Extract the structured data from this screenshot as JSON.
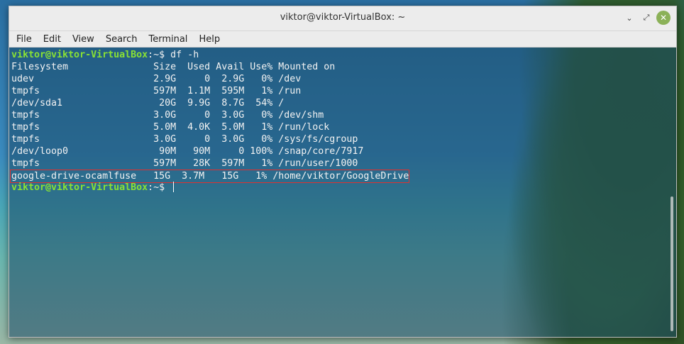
{
  "window": {
    "title": "viktor@viktor-VirtualBox: ~",
    "controls": {
      "minimize": "⌄",
      "maximize": "⤢",
      "close": "✕"
    }
  },
  "menu": {
    "items": [
      "File",
      "Edit",
      "View",
      "Search",
      "Terminal",
      "Help"
    ]
  },
  "terminal": {
    "prompt": "viktor@viktor-VirtualBox",
    "prompt_suffix": ":~$ ",
    "command": "df -h",
    "header": "Filesystem               Size  Used Avail Use% Mounted on",
    "rows": [
      "udev                     2.9G     0  2.9G   0% /dev",
      "tmpfs                    597M  1.1M  595M   1% /run",
      "/dev/sda1                 20G  9.9G  8.7G  54% /",
      "tmpfs                    3.0G     0  3.0G   0% /dev/shm",
      "tmpfs                    5.0M  4.0K  5.0M   1% /run/lock",
      "tmpfs                    3.0G     0  3.0G   0% /sys/fs/cgroup",
      "/dev/loop0                90M   90M     0 100% /snap/core/7917",
      "tmpfs                    597M   28K  597M   1% /run/user/1000"
    ],
    "highlighted_row": "google-drive-ocamlfuse   15G  3.7M   15G   1% /home/viktor/GoogleDrive",
    "second_prompt": "viktor@viktor-VirtualBox",
    "second_prompt_suffix": ":~$ "
  },
  "colors": {
    "prompt_green": "#8ae234",
    "highlight_border": "#e03030",
    "close_button": "#8bb158"
  }
}
